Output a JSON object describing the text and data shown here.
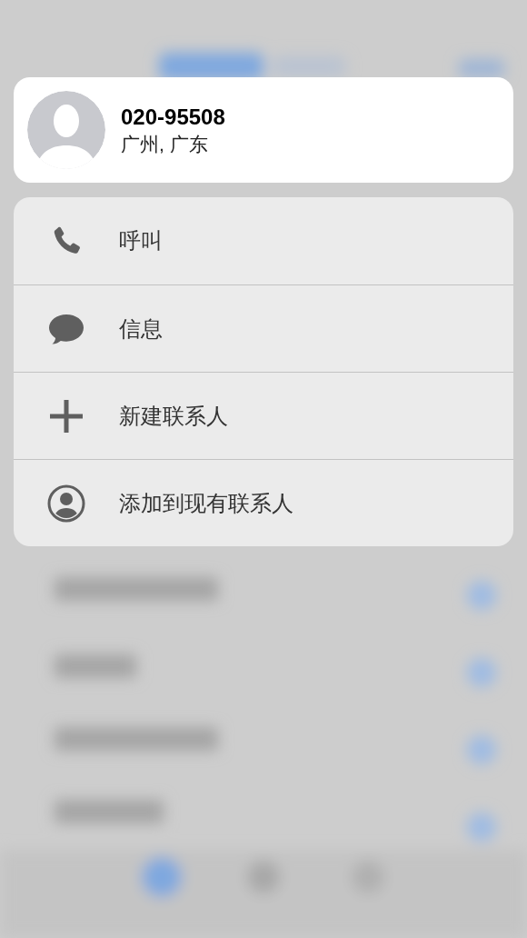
{
  "contact": {
    "number": "020-95508",
    "location": "广州, 广东"
  },
  "actions": [
    {
      "kind": "call",
      "label": "呼叫"
    },
    {
      "kind": "message",
      "label": "信息"
    },
    {
      "kind": "new",
      "label": "新建联系人"
    },
    {
      "kind": "add",
      "label": "添加到现有联系人"
    }
  ]
}
